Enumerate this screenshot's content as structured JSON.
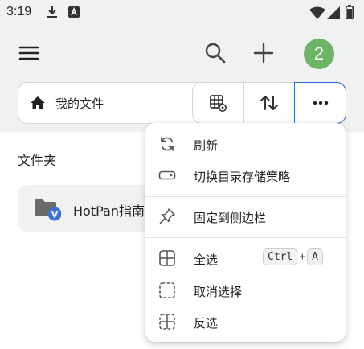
{
  "status_bar": {
    "time": "3:19",
    "icons": [
      "download-icon",
      "a-notification-icon",
      "wifi-icon",
      "signal-icon",
      "battery-icon"
    ]
  },
  "toolbar": {
    "avatar_text": "2",
    "avatar_color": "#6db466",
    "icons": [
      "menu-icon",
      "search-icon",
      "add-icon"
    ]
  },
  "breadcrumb": {
    "label": "我的文件",
    "icon": "home-icon"
  },
  "view_controls": {
    "icons": [
      "grid-settings-icon",
      "sort-icon",
      "more-icon"
    ],
    "active_color": "#2f6bd6"
  },
  "main": {
    "section_title": "文件夹",
    "folders": [
      {
        "name": "HotPan指南",
        "badge": "V",
        "badge_color": "#3b6fd8"
      }
    ]
  },
  "context_menu": {
    "items": [
      {
        "label": "刷新",
        "icon": "refresh-icon"
      },
      {
        "label": "切换目录存储策略",
        "icon": "storage-toggle-icon"
      },
      {
        "label": "固定到侧边栏",
        "icon": "pin-icon"
      },
      {
        "label": "全选",
        "icon": "select-all-icon",
        "shortcut": [
          "Ctrl",
          "A"
        ],
        "shortcut_sep": "+"
      },
      {
        "label": "取消选择",
        "icon": "deselect-icon"
      },
      {
        "label": "反选",
        "icon": "invert-selection-icon"
      }
    ]
  }
}
